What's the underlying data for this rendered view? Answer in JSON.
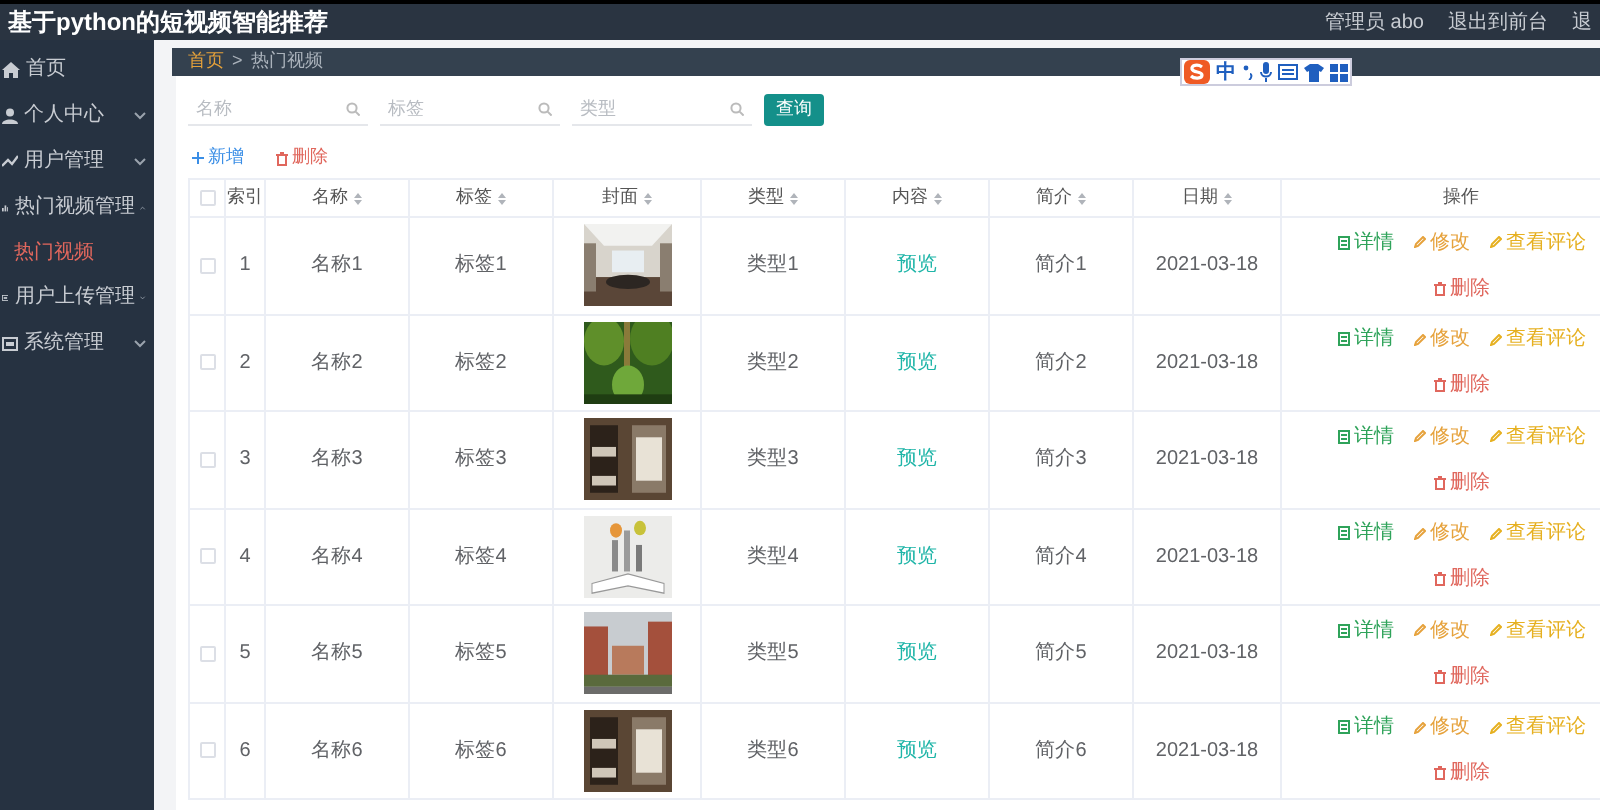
{
  "header": {
    "title": "基于python的短视频智能推荐",
    "user": "管理员 abo",
    "links": [
      "退出到前台",
      "退"
    ]
  },
  "sidebar": {
    "items": [
      {
        "label": "首页",
        "has_children": false
      },
      {
        "label": "个人中心",
        "has_children": true,
        "expanded": false
      },
      {
        "label": "用户管理",
        "has_children": true,
        "expanded": false
      },
      {
        "label": "热门视频管理",
        "has_children": true,
        "expanded": true,
        "children": [
          {
            "label": "热门视频",
            "selected": true
          }
        ]
      },
      {
        "label": "用户上传管理",
        "has_children": true,
        "expanded": false
      },
      {
        "label": "系统管理",
        "has_children": true,
        "expanded": false
      }
    ]
  },
  "breadcrumb": {
    "items": [
      "首页",
      "热门视频"
    ],
    "separator": ">"
  },
  "ime_toolbar": {
    "label": "中"
  },
  "search": {
    "fields": [
      {
        "placeholder": "名称"
      },
      {
        "placeholder": "标签"
      },
      {
        "placeholder": "类型"
      }
    ],
    "button": "查询"
  },
  "actions": {
    "add": "新增",
    "delete": "删除"
  },
  "table": {
    "columns": [
      {
        "label": "索引",
        "sortable": false
      },
      {
        "label": "名称",
        "sortable": true
      },
      {
        "label": "标签",
        "sortable": true
      },
      {
        "label": "封面",
        "sortable": true
      },
      {
        "label": "类型",
        "sortable": true
      },
      {
        "label": "内容",
        "sortable": true
      },
      {
        "label": "简介",
        "sortable": true
      },
      {
        "label": "日期",
        "sortable": true
      },
      {
        "label": "操作",
        "sortable": false
      }
    ],
    "header_checked": false,
    "rows": [
      {
        "checked": false,
        "index": "1",
        "name": "名称1",
        "tag": "标签1",
        "type": "类型1",
        "content": "预览",
        "intro": "简介1",
        "date": "2021-03-18",
        "buttons": [
          {
            "label": "详情",
            "kind": "detail"
          },
          {
            "label": "修改",
            "kind": "edit"
          },
          {
            "label": "查看评论",
            "kind": "comments"
          },
          {
            "label": "删除",
            "kind": "delete"
          }
        ]
      },
      {
        "checked": false,
        "index": "2",
        "name": "名称2",
        "tag": "标签2",
        "type": "类型2",
        "content": "预览",
        "intro": "简介2",
        "date": "2021-03-18",
        "buttons": [
          {
            "label": "详情",
            "kind": "detail"
          },
          {
            "label": "修改",
            "kind": "edit"
          },
          {
            "label": "查看评论",
            "kind": "comments"
          },
          {
            "label": "删除",
            "kind": "delete"
          }
        ]
      },
      {
        "checked": false,
        "index": "3",
        "name": "名称3",
        "tag": "标签3",
        "type": "类型3",
        "content": "预览",
        "intro": "简介3",
        "date": "2021-03-18",
        "buttons": [
          {
            "label": "详情",
            "kind": "detail"
          },
          {
            "label": "修改",
            "kind": "edit"
          },
          {
            "label": "查看评论",
            "kind": "comments"
          },
          {
            "label": "删除",
            "kind": "delete"
          }
        ]
      },
      {
        "checked": false,
        "index": "4",
        "name": "名称4",
        "tag": "标签4",
        "type": "类型4",
        "content": "预览",
        "intro": "简介4",
        "date": "2021-03-18",
        "buttons": [
          {
            "label": "详情",
            "kind": "detail"
          },
          {
            "label": "修改",
            "kind": "edit"
          },
          {
            "label": "查看评论",
            "kind": "comments"
          },
          {
            "label": "删除",
            "kind": "delete"
          }
        ]
      },
      {
        "checked": false,
        "index": "5",
        "name": "名称5",
        "tag": "标签5",
        "type": "类型5",
        "content": "预览",
        "intro": "简介5",
        "date": "2021-03-18",
        "buttons": [
          {
            "label": "详情",
            "kind": "detail"
          },
          {
            "label": "修改",
            "kind": "edit"
          },
          {
            "label": "查看评论",
            "kind": "comments"
          },
          {
            "label": "删除",
            "kind": "delete"
          }
        ]
      },
      {
        "checked": false,
        "index": "6",
        "name": "名称6",
        "tag": "标签6",
        "type": "类型6",
        "content": "预览",
        "intro": "简介6",
        "date": "2021-03-18",
        "buttons": [
          {
            "label": "详情",
            "kind": "detail"
          },
          {
            "label": "修改",
            "kind": "edit"
          },
          {
            "label": "查看评论",
            "kind": "comments"
          },
          {
            "label": "删除",
            "kind": "delete"
          }
        ]
      }
    ]
  }
}
